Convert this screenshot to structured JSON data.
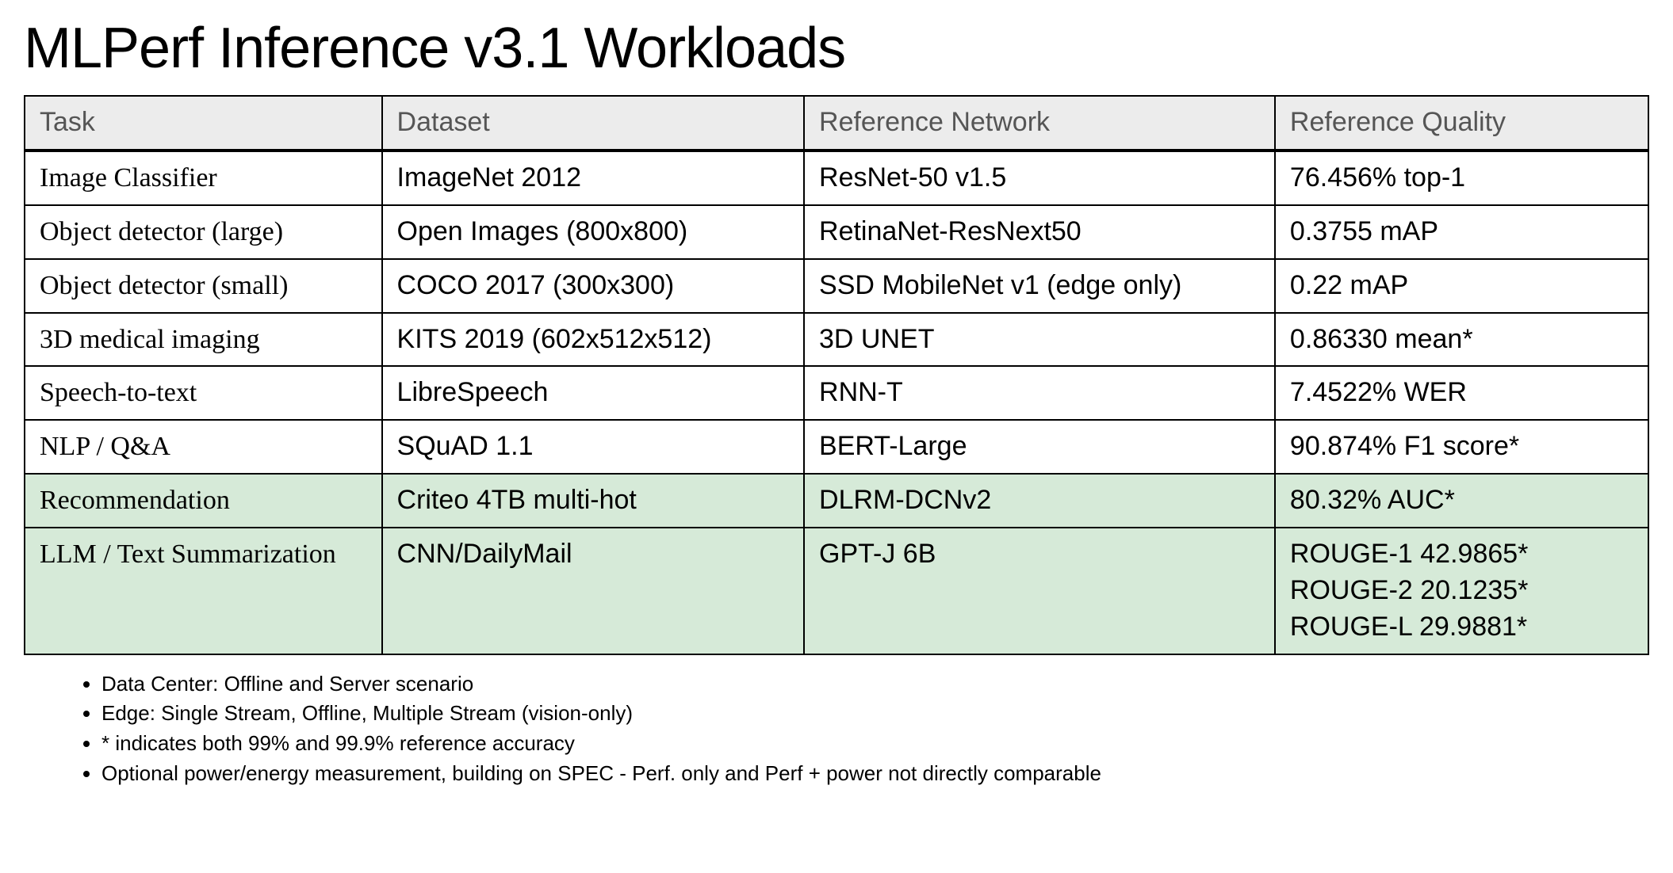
{
  "title": "MLPerf Inference v3.1 Workloads",
  "headers": {
    "task": "Task",
    "dataset": "Dataset",
    "network": "Reference Network",
    "quality": "Reference Quality"
  },
  "rows": [
    {
      "task": "Image Classifier",
      "dataset": "ImageNet 2012",
      "network": "ResNet-50 v1.5",
      "quality": [
        "76.456% top-1"
      ],
      "highlight": false
    },
    {
      "task": "Object detector (large)",
      "dataset": "Open Images (800x800)",
      "network": "RetinaNet-ResNext50",
      "quality": [
        "0.3755 mAP"
      ],
      "highlight": false
    },
    {
      "task": "Object detector (small)",
      "dataset": "COCO 2017 (300x300)",
      "network": "SSD MobileNet v1 (edge only)",
      "quality": [
        "0.22 mAP"
      ],
      "highlight": false
    },
    {
      "task": "3D medical imaging",
      "dataset": "KITS 2019 (602x512x512)",
      "network": "3D UNET",
      "quality": [
        "0.86330 mean*"
      ],
      "highlight": false
    },
    {
      "task": "Speech-to-text",
      "dataset": "LibreSpeech",
      "network": "RNN-T",
      "quality": [
        "7.4522% WER"
      ],
      "highlight": false
    },
    {
      "task": "NLP / Q&A",
      "dataset": "SQuAD 1.1",
      "network": "BERT-Large",
      "quality": [
        "90.874% F1 score*"
      ],
      "highlight": false
    },
    {
      "task": "Recommendation",
      "dataset": "Criteo 4TB multi-hot",
      "network": "DLRM-DCNv2",
      "quality": [
        "80.32% AUC*"
      ],
      "highlight": true
    },
    {
      "task": "LLM / Text Summarization",
      "dataset": "CNN/DailyMail",
      "network": "GPT-J 6B",
      "quality": [
        "ROUGE-1 42.9865*",
        "ROUGE-2 20.1235*",
        "ROUGE-L 29.9881*"
      ],
      "highlight": true
    }
  ],
  "notes": [
    "Data Center: Offline and Server scenario",
    "Edge: Single Stream, Offline, Multiple Stream (vision-only)",
    "* indicates both 99% and 99.9% reference accuracy",
    "Optional power/energy measurement, building on SPEC - Perf. only and Perf + power not directly comparable"
  ]
}
